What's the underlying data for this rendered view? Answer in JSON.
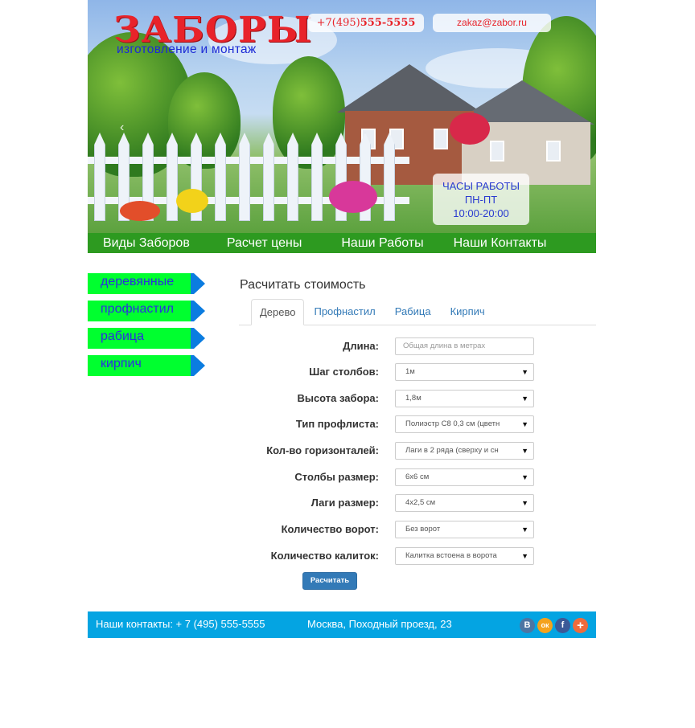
{
  "header": {
    "logo_title": "ЗАБОРЫ",
    "logo_subtitle": "изготовление и монтаж",
    "phone_prefix": "+7(495)",
    "phone_number": "555-5555",
    "email": "zakaz@zabor.ru",
    "hours_title": "ЧАСЫ РАБОТЫ",
    "hours_days": "ПН-ПТ",
    "hours_time": "10:00-20:00",
    "slider_prev_icon": "‹"
  },
  "nav": [
    {
      "label": "Виды Заборов"
    },
    {
      "label": "Расчет цены"
    },
    {
      "label": "Наши Работы"
    },
    {
      "label": "Наши Контакты"
    }
  ],
  "sidebar": {
    "items": [
      {
        "label": "деревянные"
      },
      {
        "label": "профнастил"
      },
      {
        "label": "рабица"
      },
      {
        "label": "кирпич"
      }
    ]
  },
  "calc": {
    "title": "Расчитать стоимость",
    "tabs": [
      {
        "label": "Дерево",
        "active": true
      },
      {
        "label": "Профнастил",
        "active": false
      },
      {
        "label": "Рабица",
        "active": false
      },
      {
        "label": "Кирпич",
        "active": false
      }
    ],
    "fields": [
      {
        "label": "Длина:",
        "type": "input",
        "value": "",
        "placeholder": "Общая длина в метрах"
      },
      {
        "label": "Шаг столбов:",
        "type": "select",
        "value": "1м"
      },
      {
        "label": "Высота забора:",
        "type": "select",
        "value": "1,8м"
      },
      {
        "label": "Тип профлиста:",
        "type": "select",
        "value": "Полиэстр С8 0,3 см (цветн"
      },
      {
        "label": "Кол-во горизонталей:",
        "type": "select",
        "value": "Лаги в 2 ряда (сверху и сн"
      },
      {
        "label": "Столбы размер:",
        "type": "select",
        "value": "6х6 см"
      },
      {
        "label": "Лаги размер:",
        "type": "select",
        "value": "4х2,5 см"
      },
      {
        "label": "Количество ворот:",
        "type": "select",
        "value": "Без ворот"
      },
      {
        "label": "Количество калиток:",
        "type": "select",
        "value": "Калитка встоена в ворота"
      }
    ],
    "submit_label": "Расчитать"
  },
  "footer": {
    "contacts": "Наши контакты: + 7 (495) 555-5555",
    "address": "Москва, Походный проезд, 23",
    "social": [
      {
        "icon": "vk-icon",
        "glyph": "В",
        "color": "#4c75a3"
      },
      {
        "icon": "odnoklassniki-icon",
        "glyph": "ок",
        "color": "#f4a21c"
      },
      {
        "icon": "facebook-icon",
        "glyph": "f",
        "color": "#3b5998"
      },
      {
        "icon": "plus-share-icon",
        "glyph": "+",
        "color": "#ee6b3c"
      }
    ]
  },
  "colors": {
    "nav_green": "#2d9a20",
    "sidebar_green": "#00ff2f",
    "sidebar_arrow_blue": "#0b7ce0",
    "footer_blue": "#04a4e2",
    "button_blue": "#337ab7",
    "logo_red": "#e8232a"
  }
}
